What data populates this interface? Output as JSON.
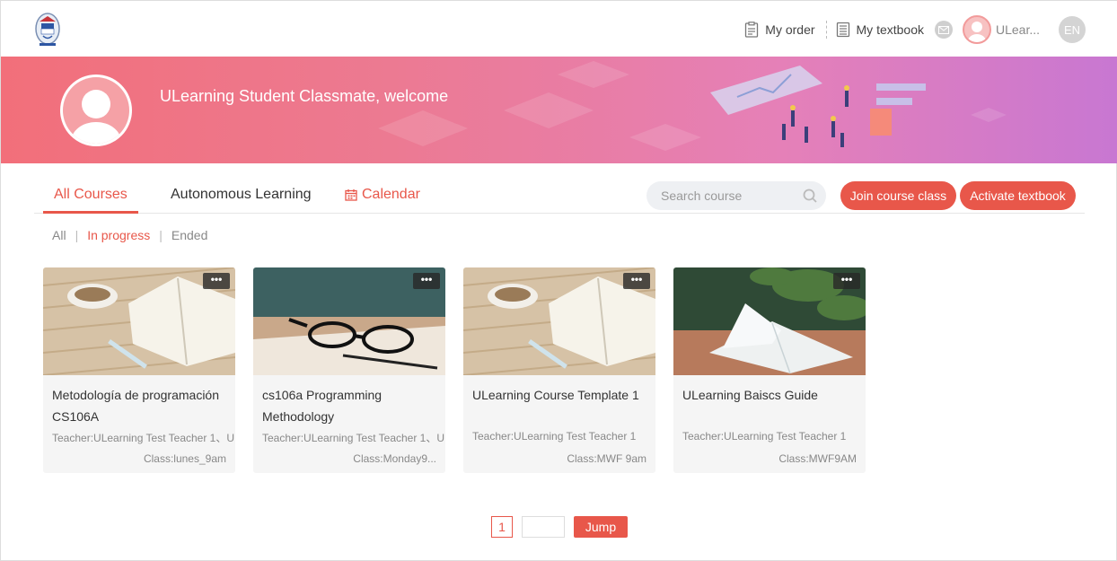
{
  "header": {
    "my_order": "My order",
    "my_textbook": "My textbook",
    "user_name": "ULear...",
    "language": "EN"
  },
  "banner": {
    "welcome": "ULearning Student Classmate, welcome"
  },
  "tabs": {
    "all_courses": "All Courses",
    "autonomous": "Autonomous Learning",
    "calendar": "Calendar"
  },
  "search": {
    "placeholder": "Search course"
  },
  "actions": {
    "join": "Join course class",
    "activate": "Activate textbook"
  },
  "filters": {
    "all": "All",
    "in_progress": "In progress",
    "ended": "Ended"
  },
  "courses": [
    {
      "title": "Metodología de programación CS106A",
      "teacher": "Teacher:ULearning Test Teacher 1、U",
      "class": "Class:lunes_9am"
    },
    {
      "title": "cs106a Programming Methodology",
      "teacher": "Teacher:ULearning Test Teacher 1、U",
      "class": "Class:Monday9..."
    },
    {
      "title": "ULearning Course Template 1",
      "teacher": "Teacher:ULearning Test Teacher 1",
      "class": "Class:MWF 9am"
    },
    {
      "title": "ULearning Baiscs Guide",
      "teacher": "Teacher:ULearning Test Teacher 1",
      "class": "Class:MWF9AM"
    }
  ],
  "pagination": {
    "current": "1",
    "jump": "Jump"
  },
  "colors": {
    "accent": "#e8574a"
  }
}
